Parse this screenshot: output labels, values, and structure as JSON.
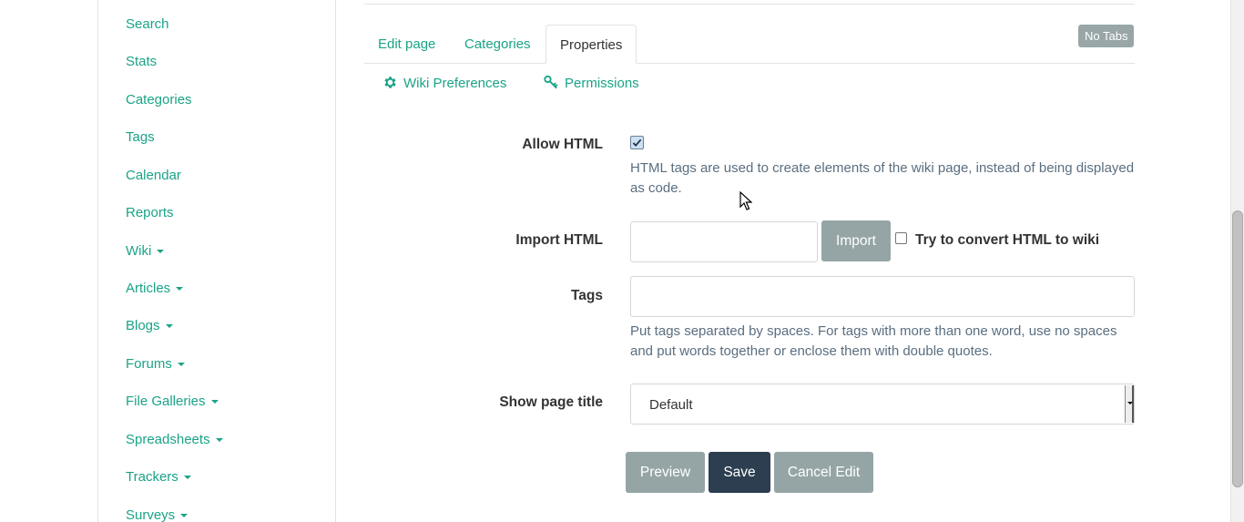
{
  "sidebar": {
    "items": [
      {
        "label": "Search",
        "caret": false
      },
      {
        "label": "Stats",
        "caret": false
      },
      {
        "label": "Categories",
        "caret": false
      },
      {
        "label": "Tags",
        "caret": false
      },
      {
        "label": "Calendar",
        "caret": false
      },
      {
        "label": "Reports",
        "caret": false
      },
      {
        "label": "Wiki",
        "caret": true
      },
      {
        "label": "Articles",
        "caret": true
      },
      {
        "label": "Blogs",
        "caret": true
      },
      {
        "label": "Forums",
        "caret": true
      },
      {
        "label": "File Galleries",
        "caret": true
      },
      {
        "label": "Spreadsheets",
        "caret": true
      },
      {
        "label": "Trackers",
        "caret": true
      },
      {
        "label": "Surveys",
        "caret": true
      }
    ]
  },
  "tabs": [
    {
      "label": "Edit page",
      "active": false
    },
    {
      "label": "Categories",
      "active": false
    },
    {
      "label": "Properties",
      "active": true
    }
  ],
  "no_tabs_label": "No Tabs",
  "subtabs": {
    "wiki_preferences": "Wiki Preferences",
    "permissions": "Permissions"
  },
  "form": {
    "allow_html": {
      "label": "Allow HTML",
      "checked": true,
      "help": "HTML tags are used to create elements of the wiki page, instead of being displayed as code."
    },
    "import_html": {
      "label": "Import HTML",
      "value": "",
      "button": "Import",
      "convert_label": "Try to convert HTML to wiki"
    },
    "tags": {
      "label": "Tags",
      "value": "",
      "help": "Put tags separated by spaces. For tags with more than one word, use no spaces and put words together or enclose them with double quotes."
    },
    "show_page_title": {
      "label": "Show page title",
      "selected": "Default"
    }
  },
  "actions": {
    "preview": "Preview",
    "save": "Save",
    "cancel": "Cancel Edit"
  },
  "colors": {
    "link": "#1aa388",
    "button_gray": "#95a5a6",
    "button_dark": "#2c3e50"
  }
}
